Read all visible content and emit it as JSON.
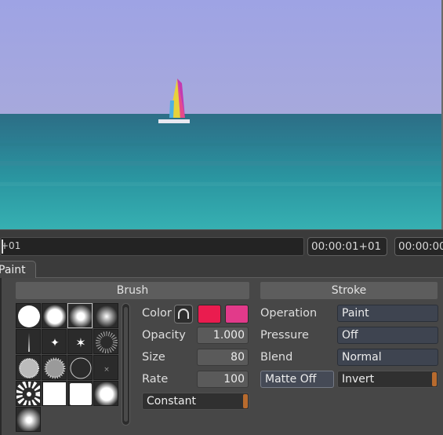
{
  "timeline": {
    "scrubber_label": "+01",
    "current_timecode": "00:00:01+01",
    "end_timecode": "00:00:00"
  },
  "tabs": {
    "paint_label": "Paint"
  },
  "brush": {
    "header": "Brush",
    "color_label": "Color",
    "primary_color": "#ea1c4f",
    "secondary_color": "#e23a8a",
    "opacity_label": "Opacity",
    "opacity_value": "1.000",
    "size_label": "Size",
    "size_value": "80",
    "rate_label": "Rate",
    "rate_value": "100",
    "rate_mode": "Constant"
  },
  "stroke": {
    "header": "Stroke",
    "operation_label": "Operation",
    "operation_value": "Paint",
    "pressure_label": "Pressure",
    "pressure_value": "Off",
    "blend_label": "Blend",
    "blend_value": "Normal",
    "matte_button": "Matte Off",
    "invert_value": "Invert"
  },
  "colors": {
    "sky": "#9a9ee0",
    "sea": "#2e8e9e",
    "panel": "#474747",
    "accent_grip": "#b86b2e"
  }
}
